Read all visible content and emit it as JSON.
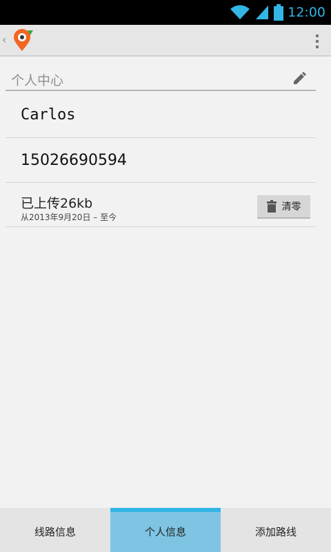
{
  "status_bar": {
    "time": "12:00",
    "icons": [
      "wifi-icon",
      "signal-icon",
      "battery-icon"
    ]
  },
  "action_bar": {
    "icons": [
      "back-caret-icon",
      "app-location-pin-icon",
      "overflow-menu-icon"
    ]
  },
  "profile": {
    "section_title": "个人中心",
    "name": "Carlos",
    "phone": "15026690594",
    "upload": {
      "amount": "已上传26kb",
      "date_range": "从2013年9月20日 – 至今",
      "clear_label": "清零"
    }
  },
  "tabs": [
    {
      "label": "线路信息",
      "active": false
    },
    {
      "label": "个人信息",
      "active": true
    },
    {
      "label": "添加路线",
      "active": false
    }
  ],
  "colors": {
    "accent": "#33b5e5",
    "active_tab": "#7fc4e3",
    "logo_orange": "#f26522",
    "logo_green": "#3aa845"
  }
}
